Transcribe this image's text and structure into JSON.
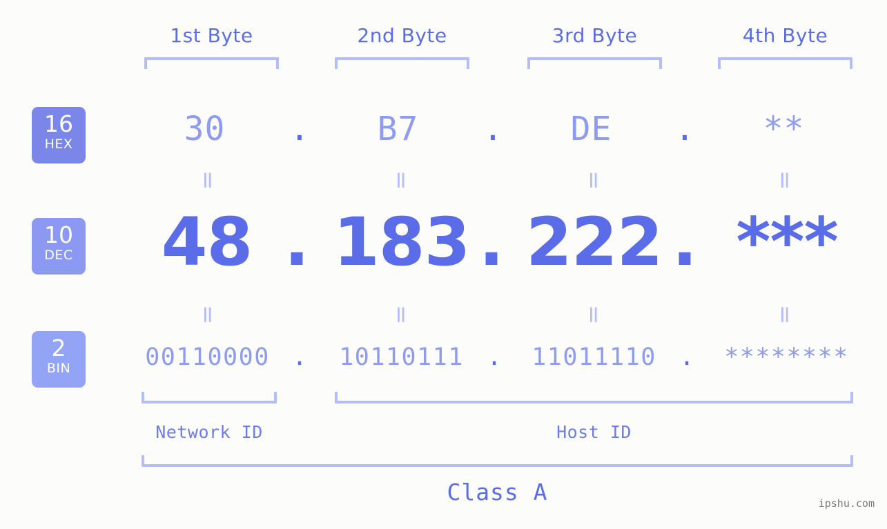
{
  "meta": {
    "background_color": "#fcfdfa",
    "accent_strong": "#5b6ce8",
    "accent_light": "#8e9bf0",
    "accent_bracket": "#b4bdfb",
    "watermark": "ipshu.com"
  },
  "byte_headers": [
    {
      "label": "1st Byte"
    },
    {
      "label": "2nd Byte"
    },
    {
      "label": "3rd Byte"
    },
    {
      "label": "4th Byte"
    }
  ],
  "radix_badges": [
    {
      "num": "16",
      "unit": "HEX",
      "color": "#7b87e8"
    },
    {
      "num": "10",
      "unit": "DEC",
      "color": "#8b99f2"
    },
    {
      "num": "2",
      "unit": "BIN",
      "color": "#93a3f5"
    }
  ],
  "rows": {
    "hex": {
      "radix": "16",
      "radix_name": "HEX",
      "values": [
        "30",
        "B7",
        "DE",
        "**"
      ],
      "separator": "."
    },
    "dec": {
      "radix": "10",
      "radix_name": "DEC",
      "values": [
        "48",
        "183",
        "222",
        "***"
      ],
      "separator": "."
    },
    "bin": {
      "radix": "2",
      "radix_name": "BIN",
      "values": [
        "00110000",
        "10110111",
        "11011110",
        "********"
      ],
      "separator": "."
    }
  },
  "equals_marks": {
    "glyph": "=",
    "count_per_gap": 4
  },
  "segments": {
    "network_id": "Network ID",
    "host_id": "Host ID",
    "class": "Class A"
  },
  "chart_data": {
    "type": "table",
    "title": "IP address byte decomposition",
    "categories": [
      "1st Byte",
      "2nd Byte",
      "3rd Byte",
      "4th Byte"
    ],
    "series": [
      {
        "name": "HEX",
        "values": [
          "30",
          "B7",
          "DE",
          "**"
        ]
      },
      {
        "name": "DEC",
        "values": [
          "48",
          "183",
          "222",
          "***"
        ]
      },
      {
        "name": "BIN",
        "values": [
          "00110000",
          "10110111",
          "11011110",
          "********"
        ]
      }
    ],
    "annotations": [
      "Network ID",
      "Host ID",
      "Class A"
    ]
  }
}
